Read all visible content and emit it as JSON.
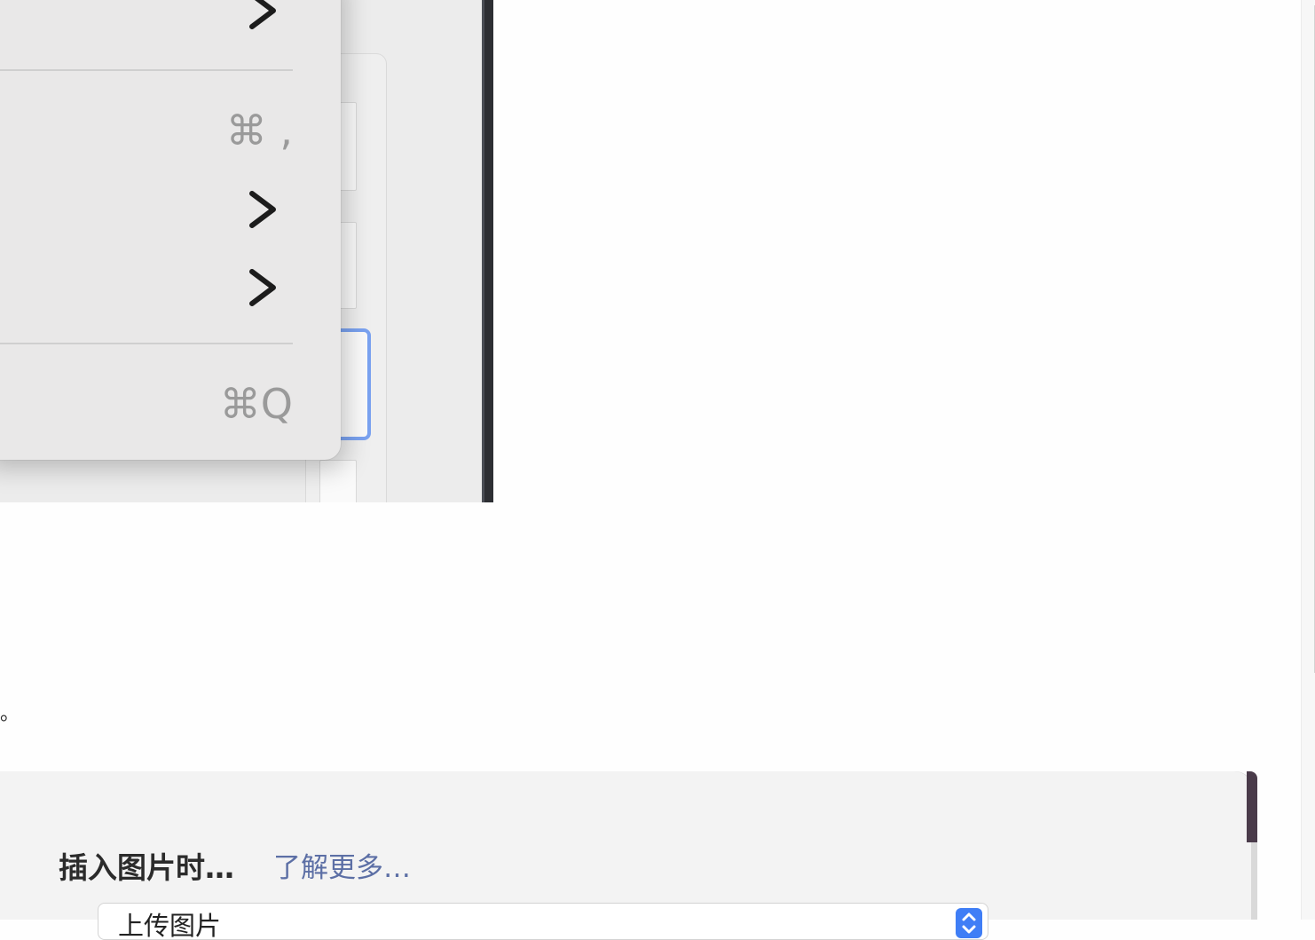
{
  "menu": {
    "shortcuts": [
      "⌘ ,",
      "⌘Q"
    ],
    "icons": [
      "chevron-right-icon",
      "chevron-right-icon",
      "chevron-right-icon"
    ]
  },
  "body_text": {
    "stray_fragment": "。"
  },
  "prefs": {
    "insert_image_label": "插入图片时…",
    "learn_more_link": "了解更多…",
    "image_action_select": "上传图片"
  },
  "colors": {
    "accent": "#3f7ef6",
    "link": "#5c6fa5",
    "focus_ring": "#7aa2f0"
  }
}
